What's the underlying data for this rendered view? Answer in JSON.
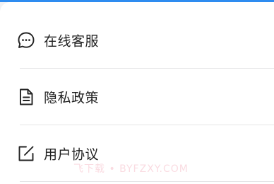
{
  "menu": {
    "items": [
      {
        "label": "在线客服",
        "icon": "chat-bubble-icon"
      },
      {
        "label": "隐私政策",
        "icon": "document-icon"
      },
      {
        "label": "用户协议",
        "icon": "edit-icon"
      }
    ]
  },
  "watermark": "飞下载 • BYFZXY.COM",
  "colors": {
    "accent": "#2e8cf0",
    "text": "#1f1f1f",
    "divider": "#e4e4e6",
    "background": "#ffffff"
  }
}
